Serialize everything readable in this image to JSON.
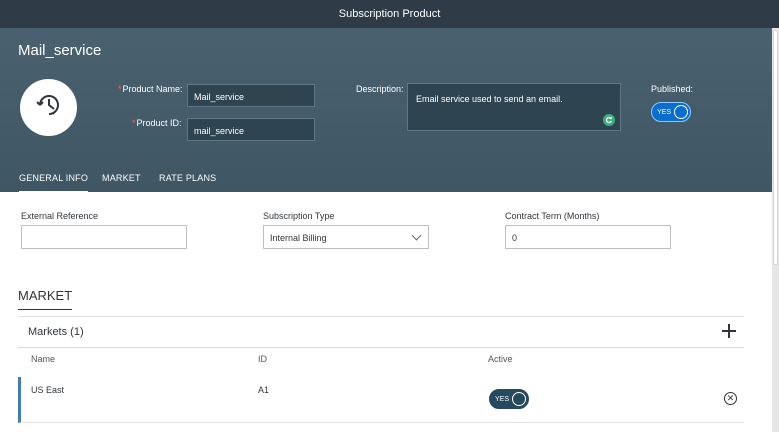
{
  "window": {
    "title": "Subscription Product"
  },
  "product": {
    "title": "Mail_service",
    "icon": "clock-history-icon",
    "name_label": "Product Name:",
    "name_value": "Mail_service",
    "id_label": "Product ID:",
    "id_value": "mail_service",
    "required_mark": "*",
    "description_label": "Description:",
    "description_value": "Email service used to send an email.",
    "published_label": "Published:",
    "published_toggle": "YES"
  },
  "tabs": [
    {
      "label": "GENERAL INFO",
      "active": true
    },
    {
      "label": "MARKET",
      "active": false
    },
    {
      "label": "RATE PLANS",
      "active": false
    }
  ],
  "general": {
    "external_reference_label": "External Reference",
    "external_reference_value": "",
    "subscription_type_label": "Subscription Type",
    "subscription_type_value": "Internal Billing",
    "contract_term_label": "Contract Term (Months)",
    "contract_term_value": "0"
  },
  "market": {
    "section_title": "MARKET",
    "panel_title": "Markets (1)",
    "columns": [
      "Name",
      "ID",
      "Active"
    ],
    "rows": [
      {
        "name": "US East",
        "id": "A1",
        "active": "YES"
      }
    ]
  },
  "colors": {
    "header_bg": "#4a6170",
    "titlebar_bg": "#2f3c48",
    "toggle_blue": "#0a6ed1",
    "toggle_dark": "#27495d",
    "row_accent": "#427cac"
  }
}
